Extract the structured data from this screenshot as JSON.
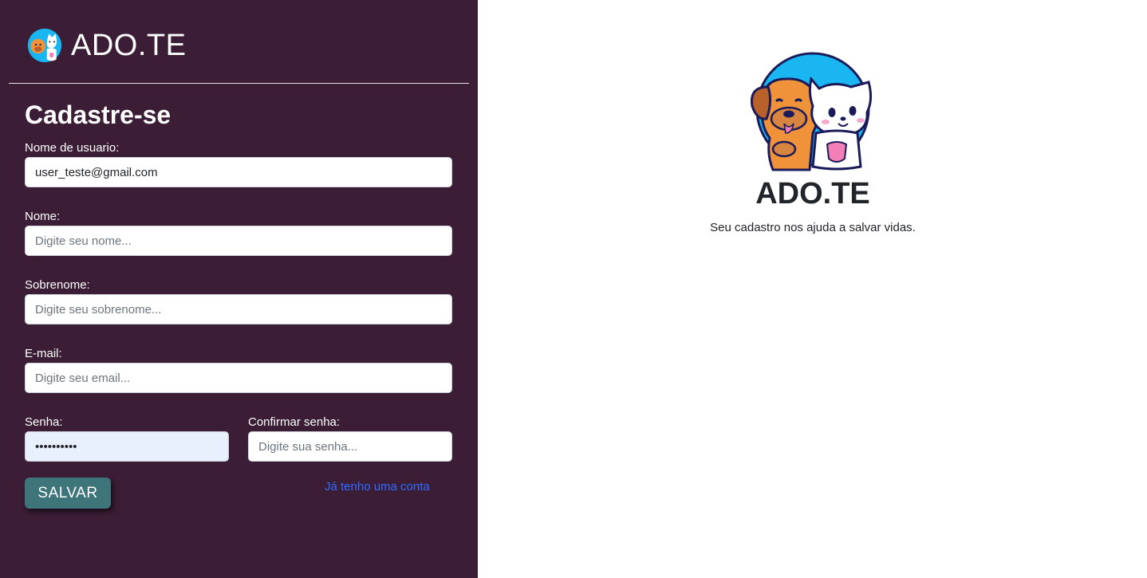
{
  "brand": {
    "title": "ADO.TE"
  },
  "form": {
    "title": "Cadastre-se",
    "username": {
      "label": "Nome de usuario:",
      "value": "user_teste@gmail.com"
    },
    "first_name": {
      "label": "Nome:",
      "placeholder": "Digite seu nome..."
    },
    "last_name": {
      "label": "Sobrenome:",
      "placeholder": "Digite seu sobrenome..."
    },
    "email": {
      "label": "E-mail:",
      "placeholder": "Digite seu email..."
    },
    "password": {
      "label": "Senha:",
      "value": "••••••••••"
    },
    "confirm_password": {
      "label": "Confirmar senha:",
      "placeholder": "Digite sua senha..."
    },
    "save_label": "SALVAR",
    "login_link_label": "Já tenho uma conta"
  },
  "hero": {
    "title": "ADO.TE",
    "subtitle": "Seu cadastro nos ajuda a salvar vidas."
  },
  "colors": {
    "sidebar_bg": "#3b1d35",
    "button_bg": "#3e757b",
    "link": "#2f6bff",
    "logo_circle": "#1ab6f2",
    "dog": "#f0923a",
    "cat": "#ffffff"
  },
  "icons": {
    "brand_logo": "dog-and-cat-logo-icon",
    "hero_logo": "dog-and-cat-logo-icon"
  }
}
